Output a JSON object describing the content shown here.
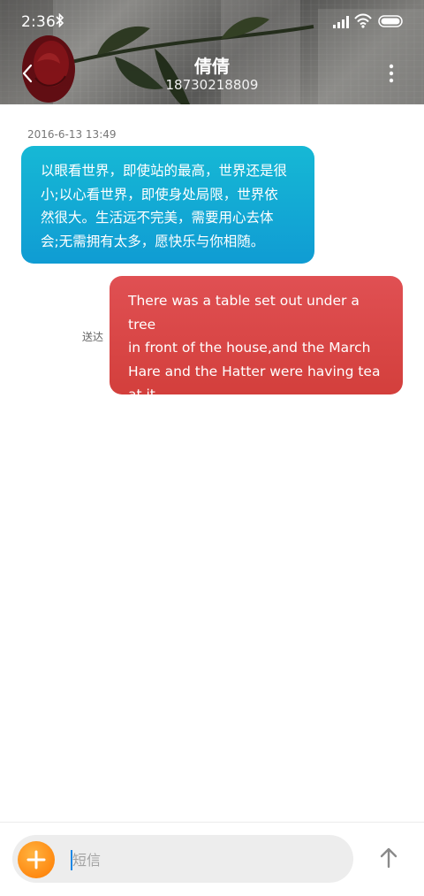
{
  "status_bar": {
    "time": "2:36",
    "icons": [
      "bluetooth-icon",
      "signal-icon",
      "wifi-icon",
      "battery-icon"
    ]
  },
  "header": {
    "contact_name": "倩倩",
    "contact_number": "18730218809",
    "icons": [
      "back-icon",
      "more-icon"
    ]
  },
  "conversation": {
    "timestamp": "2016-6-13 13:49",
    "messages": [
      {
        "direction": "incoming",
        "lines": [
          "以眼看世界，即使站的最高，世界还是很",
          "小;以心看世界，即使身处局限，世界依",
          "然很大。生活远不完美，需要用心去体",
          "会;无需拥有太多，愿快乐与你相随。"
        ],
        "color": "#14aad4"
      },
      {
        "direction": "outgoing",
        "lines": [
          "There was a table set out under a tree",
          "in front of the house,and the March",
          "Hare and the Hatter were having tea",
          "at it."
        ],
        "status": "送达",
        "color": "#da4648"
      }
    ]
  },
  "composer": {
    "placeholder": "短信",
    "value": "",
    "add_icon": "plus-icon",
    "send_icon": "arrow-up-icon",
    "accent": "#ff9419"
  }
}
